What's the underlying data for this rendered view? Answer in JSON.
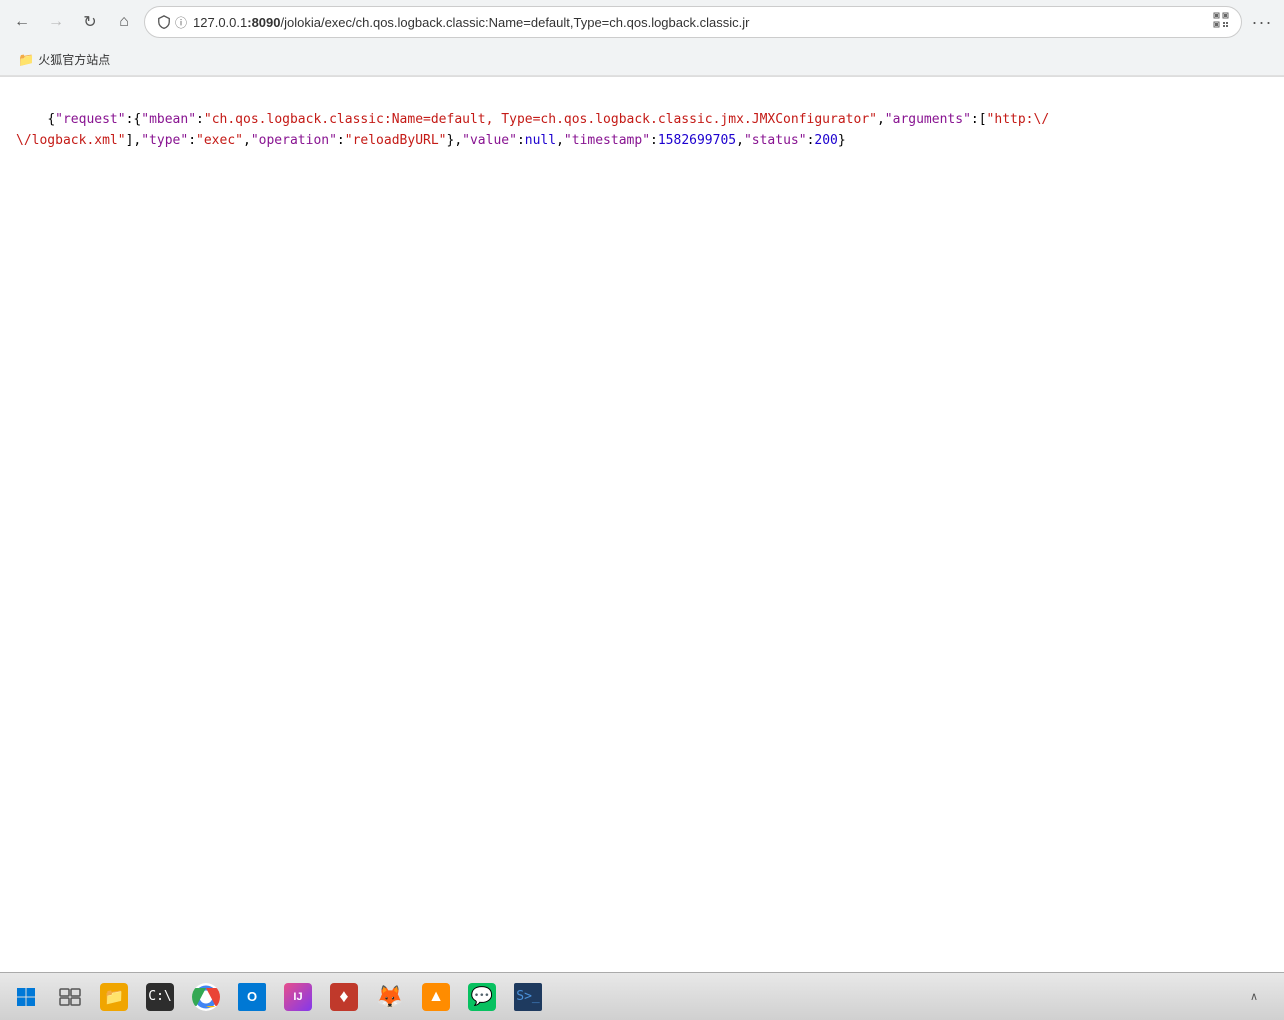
{
  "browser": {
    "url": "127.0.0.1:8090/jolokia/exec/ch.qos.logback.classic:Name=default,Type=ch.qos.logback.classic.jr",
    "url_host": "127.0.0.1",
    "url_port": ":8090",
    "url_path": "/jolokia/exec/ch.qos.logback.classic:Name=default,Type=ch.qos.logback.classic.jr",
    "security_label": "i",
    "menu_label": "···"
  },
  "bookmarks": {
    "item1_label": "火狐官方站点",
    "item1_icon": "📁"
  },
  "page": {
    "json_line1": "{\"request\":{\"mbean\":\"ch.qos.logback.classic:Name=default,Type=ch.qos.logback.classic.jmx.JMXConfigurator\",\"arguments\":[\"http:\\/",
    "json_line2": "\\/logback.xml\"],\"type\":\"exec\",\"operation\":\"reloadByURL\"},\"value\":null,\"timestamp\":1582699705,\"status\":200}"
  },
  "taskbar": {
    "apps": [
      {
        "name": "windows-start",
        "icon": "⊞",
        "color": "#0078d7"
      },
      {
        "name": "task-view",
        "icon": "⧉",
        "color": "#555"
      },
      {
        "name": "file-explorer",
        "icon": "📁",
        "color": "#f0a500"
      },
      {
        "name": "terminal",
        "icon": "⬛",
        "color": "#333"
      },
      {
        "name": "chrome",
        "icon": "🌐",
        "color": "#4285f4"
      },
      {
        "name": "outlook",
        "icon": "📧",
        "color": "#0078d4"
      },
      {
        "name": "jetbrains",
        "icon": "🔷",
        "color": "#e64f8b"
      },
      {
        "name": "app1",
        "icon": "🔴",
        "color": "#e44"
      },
      {
        "name": "firefox",
        "icon": "🦊",
        "color": "#ff6611"
      },
      {
        "name": "app2",
        "icon": "🟧",
        "color": "#f80"
      },
      {
        "name": "wechat",
        "icon": "💬",
        "color": "#07c160"
      },
      {
        "name": "terminal2",
        "icon": "▶",
        "color": "#4a90d9"
      }
    ]
  }
}
